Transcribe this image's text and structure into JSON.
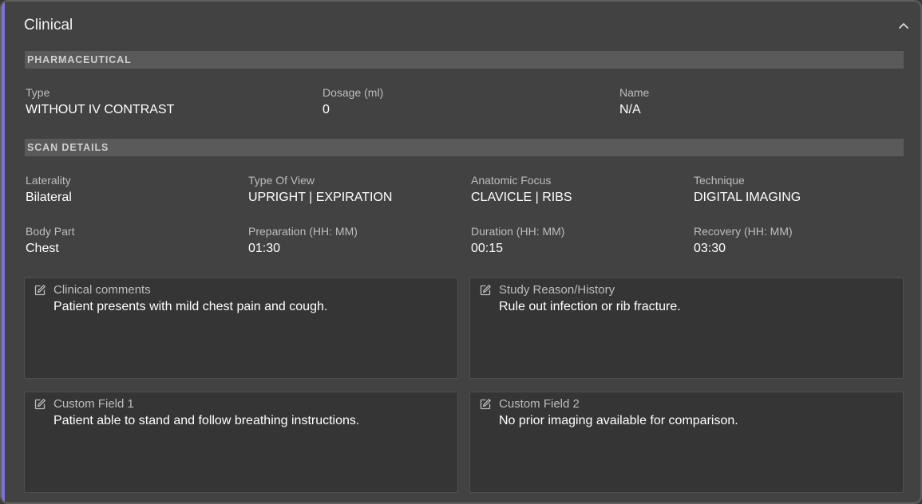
{
  "panel": {
    "title": "Clinical"
  },
  "pharmaceutical": {
    "heading": "PHARMACEUTICAL",
    "fields": [
      {
        "label": "Type",
        "value": "WITHOUT IV CONTRAST"
      },
      {
        "label": "Dosage (ml)",
        "value": "0"
      },
      {
        "label": "Name",
        "value": "N/A"
      }
    ]
  },
  "scan_details": {
    "heading": "SCAN DETAILS",
    "fields": [
      {
        "label": "Laterality",
        "value": "Bilateral"
      },
      {
        "label": "Type Of View",
        "value": "UPRIGHT | EXPIRATION"
      },
      {
        "label": "Anatomic Focus",
        "value": "CLAVICLE | RIBS"
      },
      {
        "label": "Technique",
        "value": "DIGITAL IMAGING"
      },
      {
        "label": "Body Part",
        "value": "Chest"
      },
      {
        "label": "Preparation (HH: MM)",
        "value": "01:30"
      },
      {
        "label": "Duration (HH: MM)",
        "value": "00:15"
      },
      {
        "label": "Recovery (HH: MM)",
        "value": "03:30"
      }
    ]
  },
  "notes": [
    {
      "label": "Clinical comments",
      "value": "Patient presents with mild chest pain and cough."
    },
    {
      "label": "Study Reason/History",
      "value": "Rule out infection or rib fracture."
    },
    {
      "label": "Custom Field 1",
      "value": "Patient able to stand and follow breathing instructions."
    },
    {
      "label": "Custom Field 2",
      "value": "No prior imaging available for comparison."
    }
  ],
  "icons": {
    "collapse": "chevron-up-icon",
    "edit": "edit-icon"
  },
  "colors": {
    "accent": "#7b74d6",
    "panel_bg": "#424242",
    "section_bar": "#5a5a5a",
    "note_bg": "#353535"
  }
}
